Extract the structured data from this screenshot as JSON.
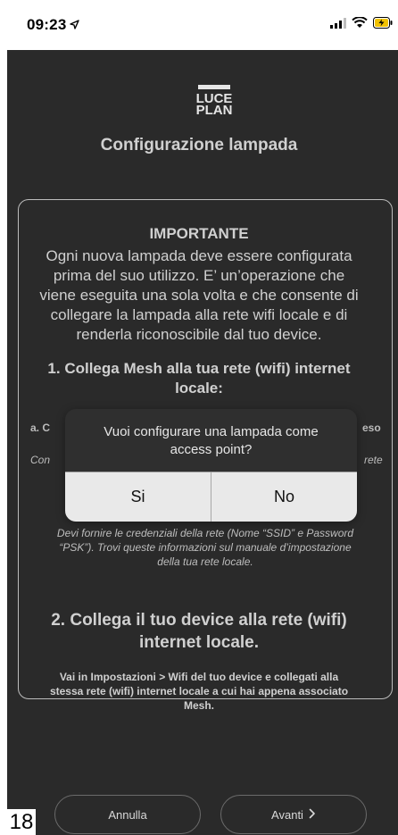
{
  "status_bar": {
    "time": "09:23",
    "icons": {
      "location": "location-arrow-icon",
      "signal": "cellular-signal-icon",
      "wifi": "wifi-icon",
      "battery": "battery-charging-icon"
    }
  },
  "app": {
    "logo": {
      "line1": "LUCE",
      "line2": "PLAN"
    },
    "title": "Configurazione lampada",
    "important": {
      "heading": "IMPORTANTE",
      "body_lines": [
        "Ogni nuova lampada deve essere configurata",
        "prima del suo utilizzo. E’ un’operazione che",
        "viene eseguita una sola volta e che consente di",
        "collegare la lampada alla rete wifi locale e di",
        "renderla riconoscibile dal tuo device."
      ]
    },
    "step1": {
      "heading_line1": "1. Collega Mesh alla tua rete (wifi) internet",
      "heading_line2": "locale:",
      "substep_left": "a. C",
      "substep_left_italic": "Con",
      "substep_right": "eso",
      "substep_right_italic": "rete",
      "credentials_lines": [
        "Devi fornire le credenziali della rete (Nome “SSID” e Password",
        "“PSK”). Trovi queste informazioni sul manuale d’impostazione",
        "della tua rete locale."
      ]
    },
    "step2": {
      "heading_line1": "2. Collega il tuo device alla rete (wifi)",
      "heading_line2": "internet locale.",
      "body_lines": [
        "Vai in Impostazioni > Wifi del tuo device e collegati alla",
        "stessa rete (wifi) internet locale a cui hai appena associato",
        "Mesh."
      ]
    },
    "dialog": {
      "message_line1": "Vuoi configurare una lampada come",
      "message_line2": "access point?",
      "yes": "Si",
      "no": "No"
    },
    "footer": {
      "cancel": "Annulla",
      "next": "Avanti",
      "page_number": "18"
    }
  }
}
